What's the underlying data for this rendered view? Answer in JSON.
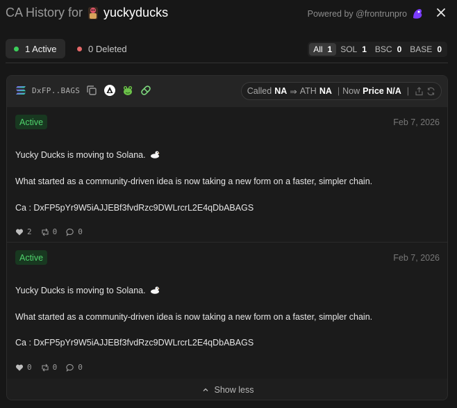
{
  "header": {
    "title_prefix": "CA History for",
    "username": "yuckyducks",
    "powered_by": "Powered by @frontrunpro",
    "avatar_icon": "user-avatar-icon",
    "brand_icon": "frontrun-logo-icon",
    "close_icon": "close-icon"
  },
  "filters": {
    "active_label": "1 Active",
    "deleted_label": "0 Deleted",
    "chains": [
      {
        "name": "All",
        "count": "1"
      },
      {
        "name": "SOL",
        "count": "1"
      },
      {
        "name": "BSC",
        "count": "0"
      },
      {
        "name": "BASE",
        "count": "0"
      }
    ]
  },
  "card": {
    "ca_short": "DxFP..BAGS",
    "chain_icon": "solana-icon",
    "icons": [
      "copy-icon",
      "axiom-icon",
      "gmgn-frog-icon",
      "pill-icon"
    ],
    "called_label": "Called",
    "called_value": "NA",
    "arrow": "⇒",
    "ath_label": "ATH",
    "ath_value": "NA",
    "sep": "|",
    "now_label": "Now",
    "now_value": "Price N/A",
    "share_icon": "share-icon",
    "refresh_icon": "refresh-icon"
  },
  "posts": [
    {
      "status": "Active",
      "date": "Feb 7, 2026",
      "line1": "Yucky Ducks is moving to Solana.",
      "line2": "What started as a community-driven idea is now taking a new form on a faster, simpler chain.",
      "line3": "Ca : DxFP5pYr9W5iAJJEBf3fvdRzc9DWLrcrL2E4qDbABAGS",
      "likes": "2",
      "retweets": "0",
      "replies": "0"
    },
    {
      "status": "Active",
      "date": "Feb 7, 2026",
      "line1": "Yucky Ducks is moving to Solana.",
      "line2": "What started as a community-driven idea is now taking a new form on a faster, simpler chain.",
      "line3": "Ca : DxFP5pYr9W5iAJJEBf3fvdRzc9DWLrcrL2E4qDbABAGS",
      "likes": "0",
      "retweets": "0",
      "replies": "0"
    }
  ],
  "show_less": "Show less",
  "colors": {
    "background": "#171717",
    "active_green": "#4fd26c",
    "deleted_red": "#e56868",
    "brand_purple": "#7b3cff"
  }
}
